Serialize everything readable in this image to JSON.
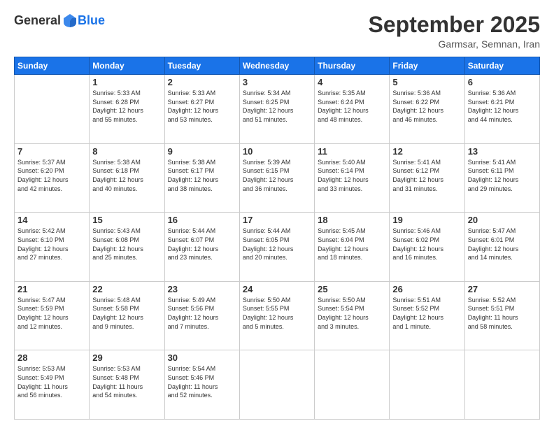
{
  "header": {
    "logo": {
      "general": "General",
      "blue": "Blue"
    },
    "title": "September 2025",
    "location": "Garmsar, Semnan, Iran"
  },
  "days_of_week": [
    "Sunday",
    "Monday",
    "Tuesday",
    "Wednesday",
    "Thursday",
    "Friday",
    "Saturday"
  ],
  "weeks": [
    [
      {
        "day": "",
        "info": ""
      },
      {
        "day": "1",
        "info": "Sunrise: 5:33 AM\nSunset: 6:28 PM\nDaylight: 12 hours\nand 55 minutes."
      },
      {
        "day": "2",
        "info": "Sunrise: 5:33 AM\nSunset: 6:27 PM\nDaylight: 12 hours\nand 53 minutes."
      },
      {
        "day": "3",
        "info": "Sunrise: 5:34 AM\nSunset: 6:25 PM\nDaylight: 12 hours\nand 51 minutes."
      },
      {
        "day": "4",
        "info": "Sunrise: 5:35 AM\nSunset: 6:24 PM\nDaylight: 12 hours\nand 48 minutes."
      },
      {
        "day": "5",
        "info": "Sunrise: 5:36 AM\nSunset: 6:22 PM\nDaylight: 12 hours\nand 46 minutes."
      },
      {
        "day": "6",
        "info": "Sunrise: 5:36 AM\nSunset: 6:21 PM\nDaylight: 12 hours\nand 44 minutes."
      }
    ],
    [
      {
        "day": "7",
        "info": "Sunrise: 5:37 AM\nSunset: 6:20 PM\nDaylight: 12 hours\nand 42 minutes."
      },
      {
        "day": "8",
        "info": "Sunrise: 5:38 AM\nSunset: 6:18 PM\nDaylight: 12 hours\nand 40 minutes."
      },
      {
        "day": "9",
        "info": "Sunrise: 5:38 AM\nSunset: 6:17 PM\nDaylight: 12 hours\nand 38 minutes."
      },
      {
        "day": "10",
        "info": "Sunrise: 5:39 AM\nSunset: 6:15 PM\nDaylight: 12 hours\nand 36 minutes."
      },
      {
        "day": "11",
        "info": "Sunrise: 5:40 AM\nSunset: 6:14 PM\nDaylight: 12 hours\nand 33 minutes."
      },
      {
        "day": "12",
        "info": "Sunrise: 5:41 AM\nSunset: 6:12 PM\nDaylight: 12 hours\nand 31 minutes."
      },
      {
        "day": "13",
        "info": "Sunrise: 5:41 AM\nSunset: 6:11 PM\nDaylight: 12 hours\nand 29 minutes."
      }
    ],
    [
      {
        "day": "14",
        "info": "Sunrise: 5:42 AM\nSunset: 6:10 PM\nDaylight: 12 hours\nand 27 minutes."
      },
      {
        "day": "15",
        "info": "Sunrise: 5:43 AM\nSunset: 6:08 PM\nDaylight: 12 hours\nand 25 minutes."
      },
      {
        "day": "16",
        "info": "Sunrise: 5:44 AM\nSunset: 6:07 PM\nDaylight: 12 hours\nand 23 minutes."
      },
      {
        "day": "17",
        "info": "Sunrise: 5:44 AM\nSunset: 6:05 PM\nDaylight: 12 hours\nand 20 minutes."
      },
      {
        "day": "18",
        "info": "Sunrise: 5:45 AM\nSunset: 6:04 PM\nDaylight: 12 hours\nand 18 minutes."
      },
      {
        "day": "19",
        "info": "Sunrise: 5:46 AM\nSunset: 6:02 PM\nDaylight: 12 hours\nand 16 minutes."
      },
      {
        "day": "20",
        "info": "Sunrise: 5:47 AM\nSunset: 6:01 PM\nDaylight: 12 hours\nand 14 minutes."
      }
    ],
    [
      {
        "day": "21",
        "info": "Sunrise: 5:47 AM\nSunset: 5:59 PM\nDaylight: 12 hours\nand 12 minutes."
      },
      {
        "day": "22",
        "info": "Sunrise: 5:48 AM\nSunset: 5:58 PM\nDaylight: 12 hours\nand 9 minutes."
      },
      {
        "day": "23",
        "info": "Sunrise: 5:49 AM\nSunset: 5:56 PM\nDaylight: 12 hours\nand 7 minutes."
      },
      {
        "day": "24",
        "info": "Sunrise: 5:50 AM\nSunset: 5:55 PM\nDaylight: 12 hours\nand 5 minutes."
      },
      {
        "day": "25",
        "info": "Sunrise: 5:50 AM\nSunset: 5:54 PM\nDaylight: 12 hours\nand 3 minutes."
      },
      {
        "day": "26",
        "info": "Sunrise: 5:51 AM\nSunset: 5:52 PM\nDaylight: 12 hours\nand 1 minute."
      },
      {
        "day": "27",
        "info": "Sunrise: 5:52 AM\nSunset: 5:51 PM\nDaylight: 11 hours\nand 58 minutes."
      }
    ],
    [
      {
        "day": "28",
        "info": "Sunrise: 5:53 AM\nSunset: 5:49 PM\nDaylight: 11 hours\nand 56 minutes."
      },
      {
        "day": "29",
        "info": "Sunrise: 5:53 AM\nSunset: 5:48 PM\nDaylight: 11 hours\nand 54 minutes."
      },
      {
        "day": "30",
        "info": "Sunrise: 5:54 AM\nSunset: 5:46 PM\nDaylight: 11 hours\nand 52 minutes."
      },
      {
        "day": "",
        "info": ""
      },
      {
        "day": "",
        "info": ""
      },
      {
        "day": "",
        "info": ""
      },
      {
        "day": "",
        "info": ""
      }
    ]
  ]
}
